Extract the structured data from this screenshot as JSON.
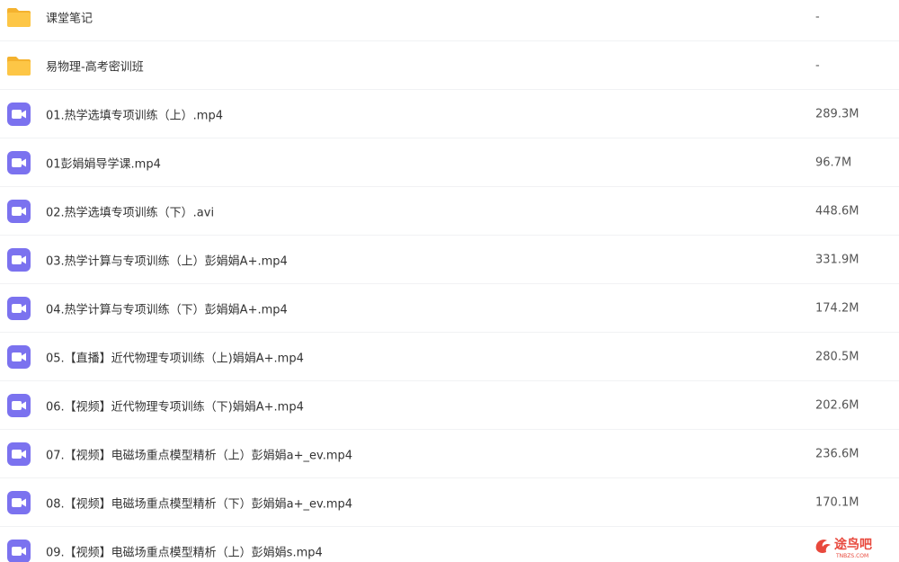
{
  "colors": {
    "folder": "#FDC646",
    "folder_tab": "#F4B22E",
    "video": "#7B72EF",
    "divider": "#F1F2F4",
    "watermark": "#E8483C"
  },
  "files": [
    {
      "name": "课堂笔记",
      "size": "-",
      "icon": "folder-icon"
    },
    {
      "name": "易物理-高考密训班",
      "size": "-",
      "icon": "folder-icon"
    },
    {
      "name": "01.热学选填专项训练（上）.mp4",
      "size": "289.3M",
      "icon": "video-icon"
    },
    {
      "name": "01彭娟娟导学课.mp4",
      "size": "96.7M",
      "icon": "video-icon"
    },
    {
      "name": "02.热学选填专项训练（下）.avi",
      "size": "448.6M",
      "icon": "video-icon"
    },
    {
      "name": "03.热学计算与专项训练（上）彭娟娟A+.mp4",
      "size": "331.9M",
      "icon": "video-icon"
    },
    {
      "name": "04.热学计算与专项训练（下）彭娟娟A+.mp4",
      "size": "174.2M",
      "icon": "video-icon"
    },
    {
      "name": "05.【直播】近代物理专项训练（上)娟娟A+.mp4",
      "size": "280.5M",
      "icon": "video-icon"
    },
    {
      "name": "06.【视频】近代物理专项训练（下)娟娟A+.mp4",
      "size": "202.6M",
      "icon": "video-icon"
    },
    {
      "name": "07.【视频】电磁场重点模型精析（上）彭娟娟a+_ev.mp4",
      "size": "236.6M",
      "icon": "video-icon"
    },
    {
      "name": "08.【视频】电磁场重点模型精析（下）彭娟娟a+_ev.mp4",
      "size": "170.1M",
      "icon": "video-icon"
    },
    {
      "name": "09.【视频】电磁场重点模型精析（上）彭娟娟s.mp4",
      "size": "",
      "icon": "video-icon"
    }
  ],
  "watermark": {
    "text": "途鸟吧",
    "subtext": "TNBZS.COM"
  }
}
